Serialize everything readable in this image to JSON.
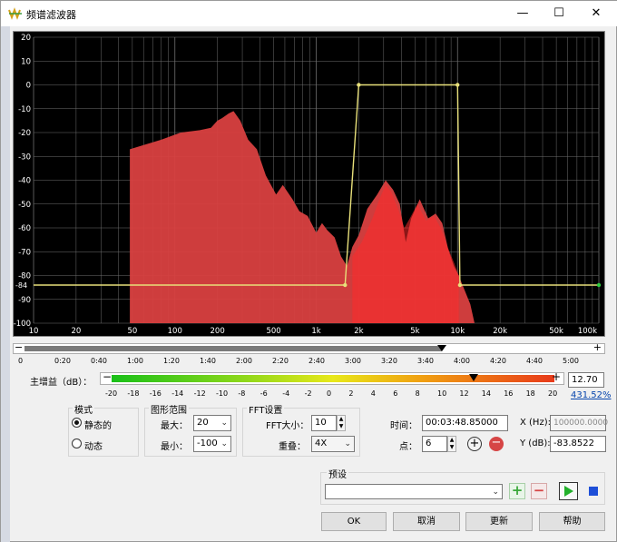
{
  "window": {
    "title": "频谱滤波器",
    "minimize": "—",
    "maximize": "☐",
    "close": "✕"
  },
  "plot": {
    "y_ticks": [
      "20",
      "10",
      "0",
      "-10",
      "-20",
      "-30",
      "-40",
      "-50",
      "-60",
      "-70",
      "-80",
      "-90",
      "-100"
    ],
    "x_ticks": [
      "10",
      "20",
      "50",
      "100",
      "200",
      "500",
      "1k",
      "2k",
      "5k",
      "10k",
      "20k",
      "50k",
      "100k"
    ],
    "left_marker": "-84",
    "colors": {
      "background": "#000000",
      "spectrum": "#d94040",
      "spectrum_peak": "#ff2a2a",
      "curve": "#e8e07a",
      "grid": "#6e6e6e",
      "end_marker": "#2ecc40"
    }
  },
  "timeline": {
    "ticks": [
      "0",
      "0:20",
      "0:40",
      "1:00",
      "1:20",
      "1:40",
      "2:00",
      "2:20",
      "2:40",
      "3:00",
      "3:20",
      "3:40",
      "4:00",
      "4:20",
      "4:40",
      "5:00"
    ],
    "minus": "−",
    "plus": "+",
    "position_fraction": 0.73
  },
  "gain": {
    "label": "主增益（dB）：",
    "minus": "−",
    "plus": "+",
    "value": "12.70",
    "percent": "431.52%",
    "scale": [
      "-20",
      "-18",
      "-16",
      "-14",
      "-12",
      "-10",
      "-8",
      "-6",
      "-4",
      "-2",
      "0",
      "2",
      "4",
      "6",
      "8",
      "10",
      "12",
      "14",
      "16",
      "18",
      "20"
    ]
  },
  "mode": {
    "title": "模式",
    "static": "静态的",
    "dynamic": "动态"
  },
  "range": {
    "title": "图形范围",
    "max_label": "最大：",
    "max_value": "20",
    "min_label": "最小：",
    "min_value": "-100"
  },
  "fft": {
    "title": "FFT设置",
    "size_label": "FFT大小：",
    "size_value": "10",
    "overlap_label": "重叠：",
    "overlap_value": "4X"
  },
  "point": {
    "time_label": "时间：",
    "time_value": "00:03:48.85000",
    "point_label": "点：",
    "point_value": "6",
    "add": "+",
    "remove": "−"
  },
  "coords": {
    "x_label": "X (Hz):",
    "x_value": "100000.0000",
    "y_label": "Y (dB):",
    "y_value": "-83.8522"
  },
  "preset": {
    "title": "预设",
    "value": "",
    "add": "+",
    "remove": "−"
  },
  "buttons": {
    "ok": "OK",
    "cancel": "取消",
    "update": "更新",
    "help": "帮助"
  }
}
